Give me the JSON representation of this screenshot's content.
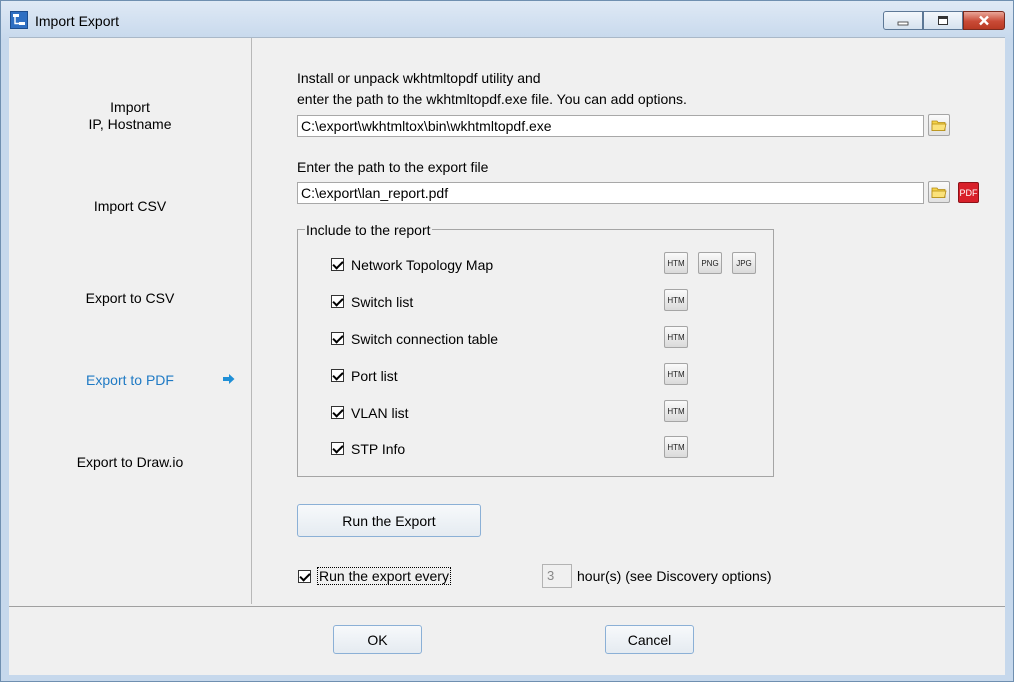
{
  "window": {
    "title": "Import Export",
    "controls": [
      "minimize-icon",
      "maximize-icon",
      "close-icon"
    ]
  },
  "sidebar": {
    "items": [
      {
        "label": "Import\nIP, Hostname"
      },
      {
        "label": "Import CSV"
      },
      {
        "label": "Export to CSV"
      },
      {
        "label": "Export to PDF",
        "active": true
      },
      {
        "label": "Export to Draw.io"
      }
    ],
    "active_icon": "arrow-right-icon",
    "accent": "#1f7ac4"
  },
  "main": {
    "instruction_line1": "Install or unpack wkhtmltopdf utility and",
    "instruction_line2": "enter the path to the wkhtmltopdf.exe file. You can add options.",
    "wkhtml_path": "C:\\export\\wkhtmltox\\bin\\wkhtmltopdf.exe",
    "export_path_label": "Enter the path to the export file",
    "export_path": "C:\\export\\lan_report.pdf",
    "pdf_button_label": "PDF",
    "report_group": {
      "title": "Include to the report",
      "items": [
        {
          "label": "Network Topology Map",
          "checked": true,
          "formats": [
            "HTM",
            "PNG",
            "JPG"
          ]
        },
        {
          "label": "Switch list",
          "checked": true,
          "formats": [
            "HTM"
          ]
        },
        {
          "label": "Switch connection table",
          "checked": true,
          "formats": [
            "HTM"
          ]
        },
        {
          "label": "Port list",
          "checked": true,
          "formats": [
            "HTM"
          ]
        },
        {
          "label": "VLAN list",
          "checked": true,
          "formats": [
            "HTM"
          ]
        },
        {
          "label": "STP Info",
          "checked": true,
          "formats": [
            "HTM"
          ]
        }
      ]
    },
    "run_button": "Run the Export",
    "schedule": {
      "label": "Run the export every",
      "checked": true,
      "hours_value": "3",
      "hours_suffix": "hour(s) (see Discovery options)"
    }
  },
  "footer": {
    "ok": "OK",
    "cancel": "Cancel"
  }
}
